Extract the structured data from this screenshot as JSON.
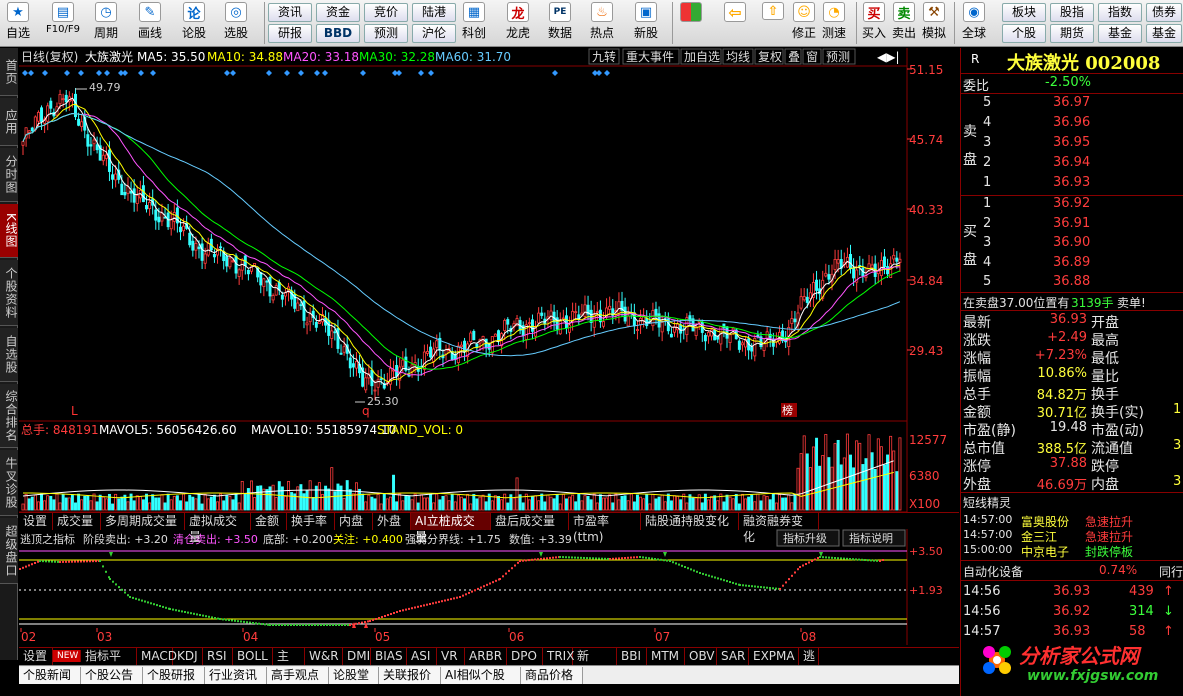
{
  "toolbar": {
    "items": [
      "自选",
      "F10/F9",
      "周期",
      "画线",
      "论股",
      "选股",
      "资讯",
      "资金",
      "竞价",
      "陆港",
      "研报",
      "BBD",
      "预测",
      "沪伦",
      "科创",
      "龙虎",
      "数据",
      "热点",
      "新股",
      "修正",
      "测速",
      "买入",
      "卖出",
      "模拟",
      "全球",
      "板块",
      "股指",
      "指数",
      "债券",
      "个股",
      "期货",
      "基金"
    ]
  },
  "leftbar": [
    "首页",
    "应用",
    "分时图",
    "K线图",
    "个股资料",
    "自选股",
    "综合排名",
    "牛叉诊股",
    "超级盘口"
  ],
  "chart": {
    "header": {
      "period": "日线(复权)",
      "name": "大族激光",
      "ma5": "MA5: 35.50",
      "ma10": "MA10: 34.88",
      "ma20": "MA20: 33.18",
      "ma30": "MA30: 32.28",
      "ma60": "MA60: 31.70"
    },
    "top_buttons": [
      "九转",
      "重大事件",
      "加自选",
      "均线",
      "复权",
      "叠",
      "窗",
      "预测"
    ],
    "price_ticks": [
      "51.15",
      "45.74",
      "40.33",
      "34.84",
      "29.43"
    ],
    "high_label": "49.79",
    "low_label": "25.30",
    "marks": {
      "L": "L",
      "q": "q",
      "bang": "榜"
    },
    "vol_header": {
      "total": "总手: 848191",
      "mavol5": "MAVOL5: 56056426.60",
      "mavol10": "MAVOL10: 55185974.10",
      "stand": "STAND_VOL: 0"
    },
    "vol_ticks": [
      "12577",
      "6380",
      "X100"
    ],
    "ind_header": {
      "name": "逃顶之指标",
      "a": "阶段卖出: +3.20",
      "b": "清仓卖出: +3.50",
      "c": "底部: +0.200",
      "d": "关注: +0.400",
      "e": "强弱分界线: +1.75",
      "f": "数值: +3.39"
    },
    "ind_ticks": [
      "+3.50",
      "+1.93"
    ],
    "ind_buttons": [
      "指标升级",
      "指标说明"
    ],
    "months": [
      "02",
      "03",
      "04",
      "05",
      "06",
      "07",
      "08"
    ]
  },
  "tabs": [
    "设置",
    "成交量",
    "多周期成交量",
    "虚拟成交量",
    "金额",
    "换手率",
    "内盘",
    "外盘",
    "AI立桩成交量",
    "盘后成交量",
    "市盈率(ttm)",
    "陆股通持股变化",
    "融资融券变化"
  ],
  "bottom_tabs": [
    "设置",
    "NEW",
    "指标平台",
    "MACD",
    "KDJ",
    "RSI",
    "BOLL",
    "主力",
    "W&R",
    "DMI",
    "BIAS",
    "ASI",
    "VR",
    "ARBR",
    "DPO",
    "TRIX",
    "新DMA",
    "BBI",
    "MTM",
    "OBV",
    "SAR",
    "EXPMA",
    "逃"
  ],
  "bottom_tabs2": [
    "个股新闻",
    "个股公告",
    "个股研报",
    "行业资讯",
    "高手观点",
    "论股堂",
    "关联报价",
    "AI相似个股",
    "商品价格"
  ],
  "quote": {
    "title": "大族激光 002008",
    "r": "R",
    "weibi_label": "委比",
    "weibi": "-2.50%",
    "sell_label": "卖盘",
    "buy_label": "买盘",
    "sell": [
      {
        "lvl": "5",
        "price": "36.97"
      },
      {
        "lvl": "4",
        "price": "36.96"
      },
      {
        "lvl": "3",
        "price": "36.95"
      },
      {
        "lvl": "2",
        "price": "36.94"
      },
      {
        "lvl": "1",
        "price": "36.93"
      }
    ],
    "buy": [
      {
        "lvl": "1",
        "price": "36.92"
      },
      {
        "lvl": "2",
        "price": "36.91"
      },
      {
        "lvl": "3",
        "price": "36.90"
      },
      {
        "lvl": "4",
        "price": "36.89"
      },
      {
        "lvl": "5",
        "price": "36.88"
      }
    ],
    "notice": "在卖盘37.00位置有",
    "notice_vol": "3139手",
    "notice_tag": "卖单!",
    "stats_left": [
      {
        "k": "最新",
        "v": "36.93",
        "c": "red"
      },
      {
        "k": "涨跌",
        "v": "+2.49",
        "c": "red"
      },
      {
        "k": "涨幅",
        "v": "+7.23%",
        "c": "red"
      },
      {
        "k": "振幅",
        "v": "10.86%",
        "c": "yel"
      },
      {
        "k": "总手",
        "v": "84.82万",
        "c": "yel"
      },
      {
        "k": "金额",
        "v": "30.71亿",
        "c": "yel"
      },
      {
        "k": "市盈(静)",
        "v": "19.48",
        "c": "wht"
      },
      {
        "k": "总市值",
        "v": "388.5亿",
        "c": "yel"
      },
      {
        "k": "涨停",
        "v": "37.88",
        "c": "red"
      },
      {
        "k": "外盘",
        "v": "46.69万",
        "c": "red"
      }
    ],
    "stats_right": [
      {
        "k": "开盘",
        "v": ""
      },
      {
        "k": "最高",
        "v": ""
      },
      {
        "k": "最低",
        "v": ""
      },
      {
        "k": "量比",
        "v": ""
      },
      {
        "k": "换手",
        "v": ""
      },
      {
        "k": "换手(实)",
        "v": "1"
      },
      {
        "k": "市盈(动)",
        "v": ""
      },
      {
        "k": "流通值",
        "v": "3"
      },
      {
        "k": "跌停",
        "v": ""
      },
      {
        "k": "内盘",
        "v": "3"
      }
    ],
    "duanxian_title": "短线精灵",
    "duanxian": [
      {
        "t": "14:57:00",
        "n": "富奥股份",
        "e": "急速拉升"
      },
      {
        "t": "14:57:00",
        "n": "金三江",
        "e": "急速拉升"
      },
      {
        "t": "15:00:00",
        "n": "中京电子",
        "e": "封跌停板"
      }
    ],
    "sector_name": "自动化设备",
    "sector_pct": "0.74%",
    "sector_more": "同行",
    "ticks": [
      {
        "t": "14:56",
        "p": "36.93",
        "v": "439",
        "d": "up"
      },
      {
        "t": "14:56",
        "p": "36.92",
        "v": "314",
        "d": "dn"
      },
      {
        "t": "14:57",
        "p": "36.93",
        "v": "58",
        "d": "up"
      }
    ]
  },
  "watermark": {
    "cn": "分析家公式网",
    "url": "www.fxjgsw.com"
  },
  "chart_data": {
    "type": "candlestick",
    "title": "大族激光 日线(复权)",
    "ylim": [
      24,
      52
    ],
    "high": 49.79,
    "low": 25.3,
    "last_close": 36.93,
    "ma": {
      "MA5": 35.5,
      "MA10": 34.88,
      "MA20": 33.18,
      "MA30": 32.28,
      "MA60": 31.7
    },
    "x_months": [
      "02",
      "03",
      "04",
      "05",
      "06",
      "07",
      "08"
    ]
  }
}
